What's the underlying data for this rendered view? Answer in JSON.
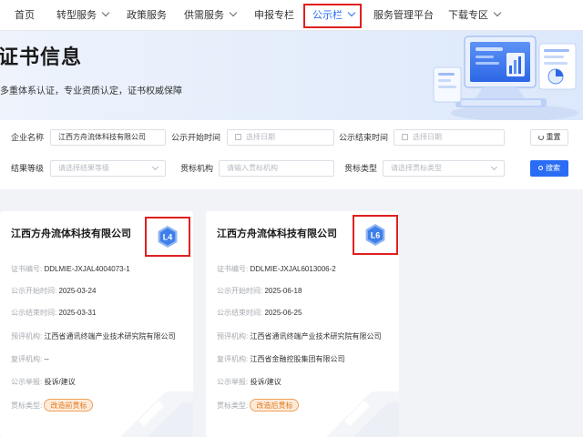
{
  "nav": {
    "items": [
      {
        "label": "首页",
        "dropdown": false
      },
      {
        "label": "转型服务",
        "dropdown": true
      },
      {
        "label": "政策服务",
        "dropdown": false
      },
      {
        "label": "供需服务",
        "dropdown": true
      },
      {
        "label": "申报专栏",
        "dropdown": false
      },
      {
        "label": "公示栏",
        "dropdown": true,
        "active": true
      },
      {
        "label": "服务管理平台",
        "dropdown": false
      },
      {
        "label": "下载专区",
        "dropdown": true
      }
    ]
  },
  "banner": {
    "title": "证书信息",
    "subtitle": "多重体系认证，专业资质认定，证书权威保障"
  },
  "filters": {
    "company_label": "企业名称",
    "company_value": "江西方舟流体科技有限公司",
    "start_label": "公示开始时间",
    "start_placeholder": "选择日期",
    "end_label": "公示结束时间",
    "end_placeholder": "选择日期",
    "reset_label": "重置",
    "level_label": "结果等级",
    "level_placeholder": "请选择结果等级",
    "org_label": "贯标机构",
    "org_placeholder": "请输入贯标机构",
    "type_label": "贯标类型",
    "type_placeholder": "请选择贯标类型",
    "search_label": "搜索"
  },
  "cards": [
    {
      "company": "江西方舟流体科技有限公司",
      "level": "L4",
      "cert_no_label": "证书编号:",
      "cert_no": "DDLMIE-JXJAL4004073-1",
      "start_label": "公示开始时间:",
      "start": "2025-03-24",
      "end_label": "公示结束时间:",
      "end": "2025-03-31",
      "eval_label": "预评机构:",
      "eval": "江西省通讯终端产业技术研究院有限公司",
      "review_label": "复评机构:",
      "review": "--",
      "report_label": "公示举报:",
      "report": "投诉/建议",
      "type_label": "贯标类型:",
      "type": "改造前贯标"
    },
    {
      "company": "江西方舟流体科技有限公司",
      "level": "L6",
      "cert_no_label": "证书编号:",
      "cert_no": "DDLMIE-JXJAL6013006-2",
      "start_label": "公示开始时间:",
      "start": "2025-06-18",
      "end_label": "公示结束时间:",
      "end": "2025-06-25",
      "eval_label": "预评机构:",
      "eval": "江西省通讯终端产业技术研究院有限公司",
      "review_label": "复评机构:",
      "review": "江西省金融控股集团有限公司",
      "report_label": "公示举报:",
      "report": "投诉/建议",
      "type_label": "贯标类型:",
      "type": "改造后贯标"
    }
  ],
  "colors": {
    "accent": "#2a6df4",
    "highlight": "#e02020",
    "tag_text": "#e07a20",
    "tag_bg": "#fdebd9"
  }
}
